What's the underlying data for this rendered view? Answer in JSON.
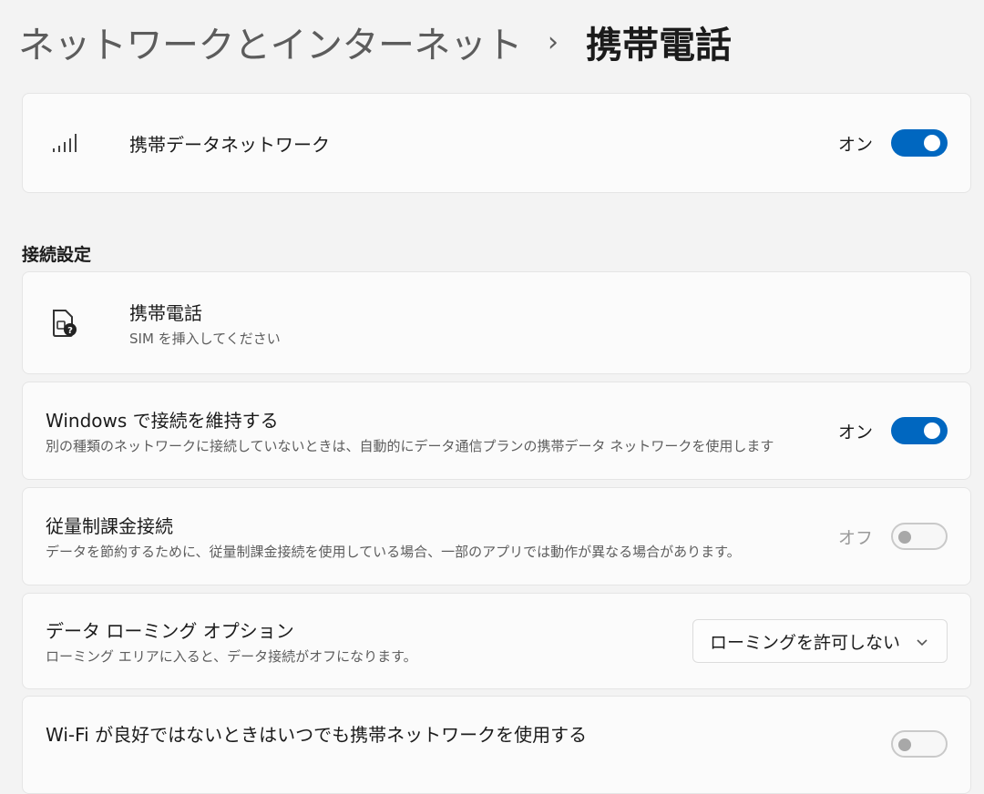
{
  "breadcrumb": {
    "parent": "ネットワークとインターネット",
    "separator": "›",
    "current": "携帯電話"
  },
  "cellular": {
    "icon": "signal-bars-icon",
    "title": "携帯データネットワーク",
    "state_label": "オン",
    "on": true
  },
  "section": {
    "label": "接続設定"
  },
  "sim": {
    "icon": "sim-card-question-icon",
    "title": "携帯電話",
    "subtitle": "SIM を挿入してください"
  },
  "keep_connected": {
    "title": "Windows で接続を維持する",
    "description": "別の種類のネットワークに接続していないときは、自動的にデータ通信プランの携帯データ ネットワークを使用します",
    "state_label": "オン",
    "on": true
  },
  "metered": {
    "title": "従量制課金接続",
    "description": "データを節約するために、従量制課金接続を使用している場合、一部のアプリでは動作が異なる場合があります。",
    "state_label": "オフ",
    "on": false
  },
  "roaming": {
    "title": "データ ローミング オプション",
    "description": "ローミング エリアに入ると、データ接続がオフになります。",
    "selected": "ローミングを許可しない"
  },
  "wifi_fallback": {
    "title": "Wi-Fi が良好ではないときはいつでも携帯ネットワークを使用する"
  },
  "colors": {
    "accent": "#0067c0",
    "background": "#f3f3f3",
    "card": "#fbfbfb"
  }
}
